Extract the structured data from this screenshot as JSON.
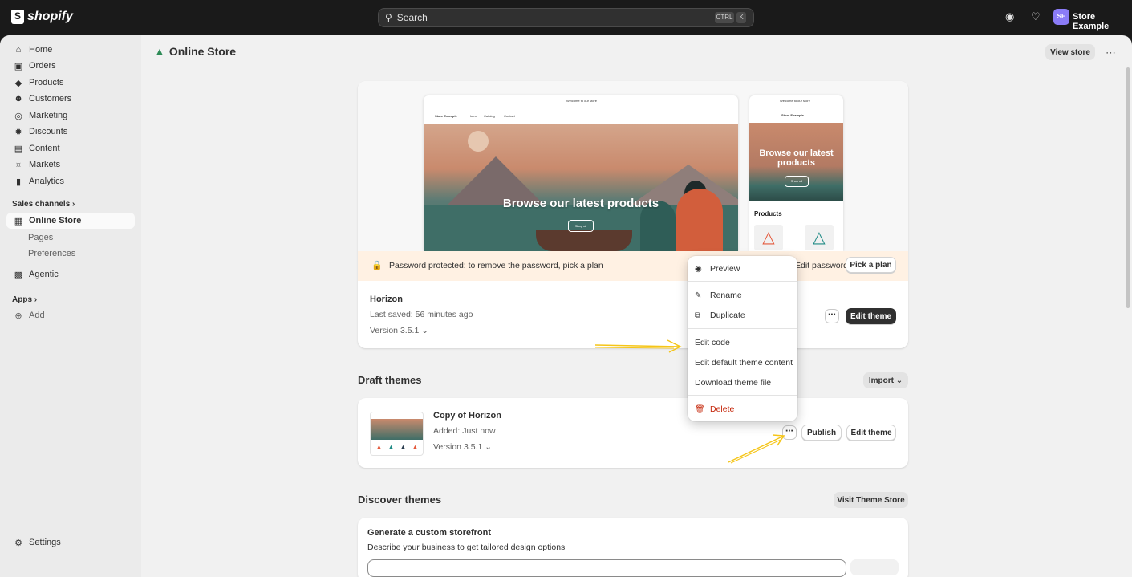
{
  "topbar": {
    "logo_text": "shopify",
    "search_placeholder": "Search",
    "kbd_ctrl": "CTRL",
    "kbd_k": "K",
    "avatar_initials": "SE",
    "store_name": "Store Example"
  },
  "sidebar": {
    "items": [
      {
        "label": "Home",
        "icon": "home-icon"
      },
      {
        "label": "Orders",
        "icon": "orders-icon"
      },
      {
        "label": "Products",
        "icon": "tag-icon"
      },
      {
        "label": "Customers",
        "icon": "person-icon"
      },
      {
        "label": "Marketing",
        "icon": "target-icon"
      },
      {
        "label": "Discounts",
        "icon": "discount-icon"
      },
      {
        "label": "Content",
        "icon": "content-icon"
      },
      {
        "label": "Markets",
        "icon": "globe-icon"
      },
      {
        "label": "Analytics",
        "icon": "bar-chart-icon"
      }
    ],
    "sales_channels_label": "Sales channels",
    "online_store": "Online Store",
    "pages": "Pages",
    "preferences": "Preferences",
    "agentic": "Agentic",
    "apps_label": "Apps",
    "add": "Add",
    "settings": "Settings"
  },
  "header": {
    "title": "Online Store",
    "view_store": "View store"
  },
  "preview": {
    "welcome": "Welcome to our store",
    "nav_store": "Store Example",
    "nav_home": "Home",
    "nav_catalog": "Catalog",
    "nav_contact": "Contact",
    "hero_text": "Browse our latest products",
    "shop_all": "Shop all",
    "mobile_hero_text": "Browse our latest products",
    "mobile_products": "Products"
  },
  "banner": {
    "text": "Password protected: to remove the password, pick a plan",
    "edit_password": "Edit password",
    "pick_plan": "Pick a plan"
  },
  "current_theme": {
    "name": "Horizon",
    "last_saved": "Last saved: 56 minutes ago",
    "version": "Version 3.5.1",
    "edit_theme": "Edit theme"
  },
  "draft_themes": {
    "title": "Draft themes",
    "import": "Import",
    "item": {
      "name": "Copy of Horizon",
      "added": "Added: Just now",
      "version": "Version 3.5.1",
      "publish": "Publish",
      "edit_theme": "Edit theme"
    }
  },
  "context_menu": {
    "preview": "Preview",
    "rename": "Rename",
    "duplicate": "Duplicate",
    "edit_code": "Edit code",
    "edit_default": "Edit default theme content",
    "download": "Download theme file",
    "delete": "Delete"
  },
  "discover": {
    "title": "Discover themes",
    "visit_store": "Visit Theme Store",
    "generate_title": "Generate a custom storefront",
    "generate_desc": "Describe your business to get tailored design options"
  },
  "colors": {
    "accent_dark": "#303030",
    "banner_bg": "#fff1e3",
    "danger": "#c5280c",
    "annotation_arrow": "#f5c518"
  }
}
